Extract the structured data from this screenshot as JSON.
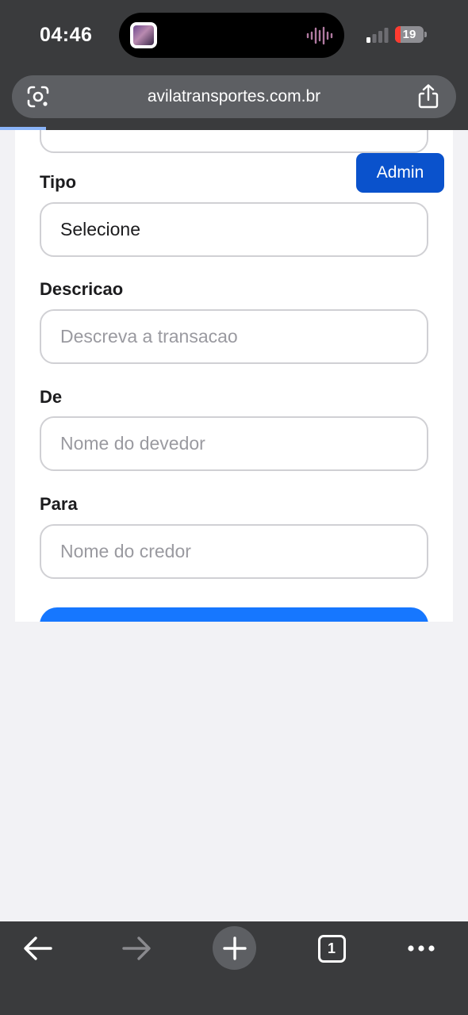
{
  "status_bar": {
    "time": "04:46",
    "battery_level": "19",
    "battery_fraction": 0.19,
    "signal_icon": "cellular-signal-icon",
    "activity_icon": "audio-waveform-icon"
  },
  "browser": {
    "url": "avilatransportes.com.br",
    "lens_icon": "google-lens-icon",
    "share_icon": "share-icon",
    "load_progress": 0.1
  },
  "form": {
    "tipo": {
      "label": "Tipo",
      "value": "Selecione"
    },
    "descricao": {
      "label": "Descricao",
      "placeholder": "Descreva a transacao"
    },
    "de": {
      "label": "De",
      "placeholder": "Nome do devedor"
    },
    "para": {
      "label": "Para",
      "placeholder": "Nome do credor"
    }
  },
  "admin_button": {
    "label": "Admin"
  },
  "toolbar": {
    "tab_count": "1",
    "icons": [
      "back-arrow-icon",
      "forward-arrow-icon",
      "plus-icon",
      "tabs-icon",
      "more-icon"
    ]
  },
  "colors": {
    "chrome": "#3a3b3d",
    "url_pill": "#5d5f63",
    "primary_button": "#1677ff",
    "admin_button": "#0a52cc",
    "battery_low": "#ff3b30",
    "page_background": "#f2f2f5"
  }
}
